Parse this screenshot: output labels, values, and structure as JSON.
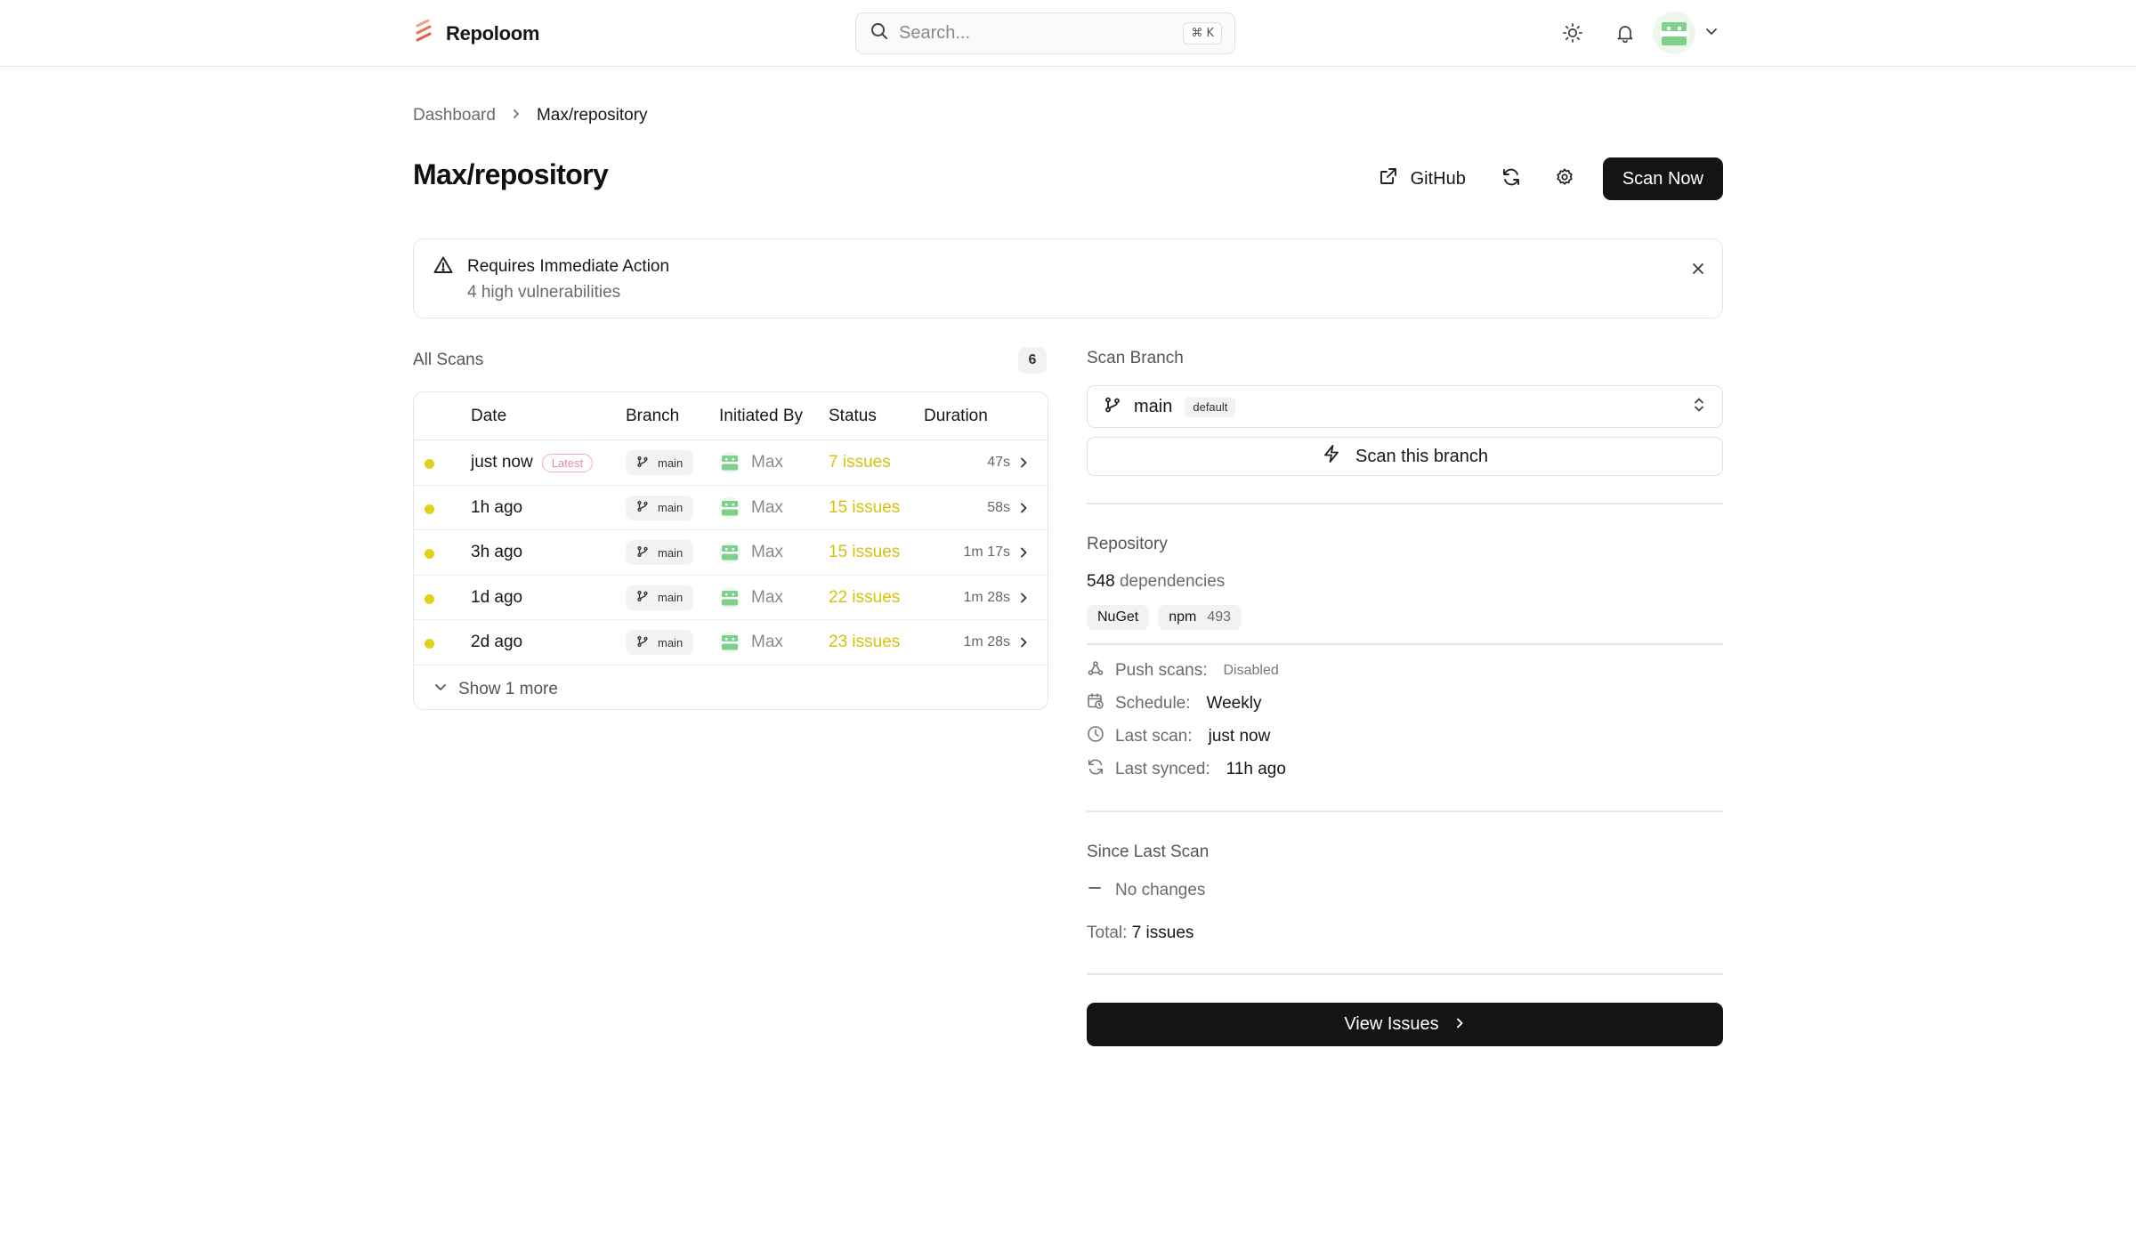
{
  "app": {
    "name": "Repoloom"
  },
  "search": {
    "placeholder": "Search...",
    "shortcut": "⌘ K"
  },
  "breadcrumb": {
    "items": [
      "Dashboard",
      "Max/repository"
    ]
  },
  "page": {
    "title": "Max/repository"
  },
  "header_actions": {
    "github_label": "GitHub",
    "scan_now_label": "Scan Now"
  },
  "alert": {
    "title": "Requires Immediate Action",
    "description": "4 high vulnerabilities"
  },
  "scans": {
    "label": "All Scans",
    "count": "6",
    "columns": [
      "Date",
      "Branch",
      "Initiated By",
      "Status",
      "Duration"
    ],
    "rows": [
      {
        "date": "just now",
        "badge": "Latest",
        "branch": "main",
        "user": "Max",
        "status": "7 issues",
        "duration": "47s"
      },
      {
        "date": "1h ago",
        "badge": "",
        "branch": "main",
        "user": "Max",
        "status": "15 issues",
        "duration": "58s"
      },
      {
        "date": "3h ago",
        "badge": "",
        "branch": "main",
        "user": "Max",
        "status": "15 issues",
        "duration": "1m 17s"
      },
      {
        "date": "1d ago",
        "badge": "",
        "branch": "main",
        "user": "Max",
        "status": "22 issues",
        "duration": "1m 28s"
      },
      {
        "date": "2d ago",
        "badge": "",
        "branch": "main",
        "user": "Max",
        "status": "23 issues",
        "duration": "1m 28s"
      }
    ],
    "show_more": "Show 1 more"
  },
  "scan_branch": {
    "label": "Scan Branch",
    "selected": "main",
    "selected_badge": "default",
    "scan_button": "Scan this branch"
  },
  "repository": {
    "label": "Repository",
    "dependency_count": "548",
    "dependency_word": "dependencies",
    "tags": [
      {
        "name": "NuGet",
        "count": ""
      },
      {
        "name": "npm",
        "count": "493"
      }
    ],
    "push_scans": {
      "label": "Push scans:",
      "value": "Disabled"
    },
    "schedule": {
      "label": "Schedule:",
      "value": "Weekly"
    },
    "last_scan": {
      "label": "Last scan:",
      "value": "just now"
    },
    "last_synced": {
      "label": "Last synced:",
      "value": "11h ago"
    }
  },
  "since_last_scan": {
    "label": "Since Last Scan",
    "change": "No changes",
    "total_label": "Total:",
    "total_value": "7 issues"
  },
  "view_issues_label": "View Issues",
  "colors": {
    "accent_dark": "#141414",
    "status_yellow": "#d6c20c",
    "dot_yellow": "#e0d21a",
    "brand_logo": "#e8735a",
    "latest_pink": "#e58aa3"
  }
}
